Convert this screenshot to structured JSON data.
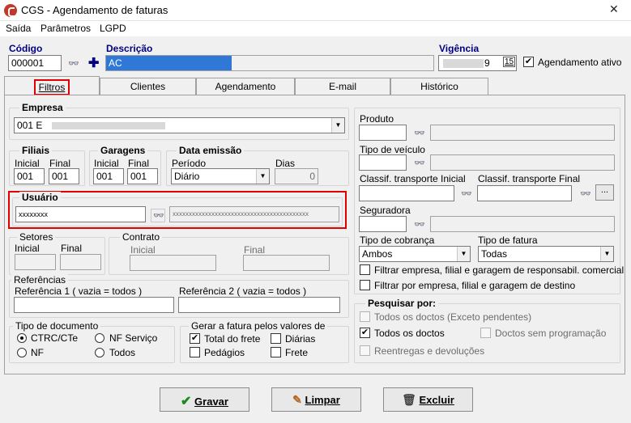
{
  "window": {
    "title": "CGS - Agendamento de faturas"
  },
  "menu": [
    "Saída",
    "Parâmetros",
    "LGPD"
  ],
  "header": {
    "codigo_label": "Código",
    "codigo_value": "000001",
    "descricao_label": "Descrição",
    "descricao_value": "AC",
    "vigencia_label": "Vigência",
    "vigencia_value": "9",
    "vigencia_cal": "15",
    "agendamento_ativo_label": "Agendamento ativo"
  },
  "tabs": [
    "Filtros",
    "Clientes",
    "Agendamento",
    "E-mail",
    "Histórico"
  ],
  "empresa": {
    "label": "Empresa",
    "value": "001 E"
  },
  "filiais": {
    "label": "Filiais",
    "inicial_label": "Inicial",
    "final_label": "Final",
    "inicial": "001",
    "final": "001"
  },
  "garagens": {
    "label": "Garagens",
    "inicial_label": "Inicial",
    "final_label": "Final",
    "inicial": "001",
    "final": "001"
  },
  "data_emissao": {
    "label": "Data emissão",
    "periodo_label": "Período",
    "periodo_value": "Diário",
    "dias_label": "Dias",
    "dias_value": "0"
  },
  "usuario": {
    "label": "Usuário",
    "value": "xxxxxxxx",
    "name": "xxxxxxxxxxxxxxxxxxxxxxxxxxxxxxxxxxxxxxxxxx"
  },
  "setores": {
    "label": "Setores",
    "inicial_label": "Inicial",
    "final_label": "Final"
  },
  "contrato": {
    "label": "Contrato",
    "inicial_label": "Inicial",
    "final_label": "Final"
  },
  "referencias": {
    "label": "Referências",
    "ref1_label": "Referência 1 ( vazia = todos )",
    "ref2_label": "Referência 2 ( vazia = todos )"
  },
  "tipo_documento": {
    "label": "Tipo de documento",
    "options": [
      "CTRC/CTe",
      "NF Serviço",
      "NF",
      "Todos"
    ]
  },
  "gerar_fatura": {
    "label": "Gerar a fatura pelos valores de",
    "options": [
      "Total do frete",
      "Diárias",
      "Pedágios",
      "Frete"
    ]
  },
  "right": {
    "produto_label": "Produto",
    "tipo_veiculo_label": "Tipo de veículo",
    "classif_inicial_label": "Classif. transporte Inicial",
    "classif_final_label": "Classif. transporte Final",
    "ellipsis": "...",
    "seguradora_label": "Seguradora",
    "tipo_cobranca_label": "Tipo de cobrança",
    "tipo_cobranca_value": "Ambos",
    "tipo_fatura_label": "Tipo de fatura",
    "tipo_fatura_value": "Todas",
    "filtrar1": "Filtrar empresa, filial e garagem de responsabil. comercial",
    "filtrar2": "Filtrar por empresa, filial e garagem de destino"
  },
  "pesquisar": {
    "label": "Pesquisar por:",
    "todos_exceto": "Todos os doctos (Exceto pendentes)",
    "todos": "Todos os doctos",
    "sem_programacao": "Doctos sem programação",
    "reentregas": "Reentregas e devoluções"
  },
  "buttons": {
    "gravar": "Gravar",
    "limpar": "Limpar",
    "excluir": "Excluir"
  },
  "colors": {
    "accent_blue": "#000080",
    "highlight_red": "#e00000"
  }
}
